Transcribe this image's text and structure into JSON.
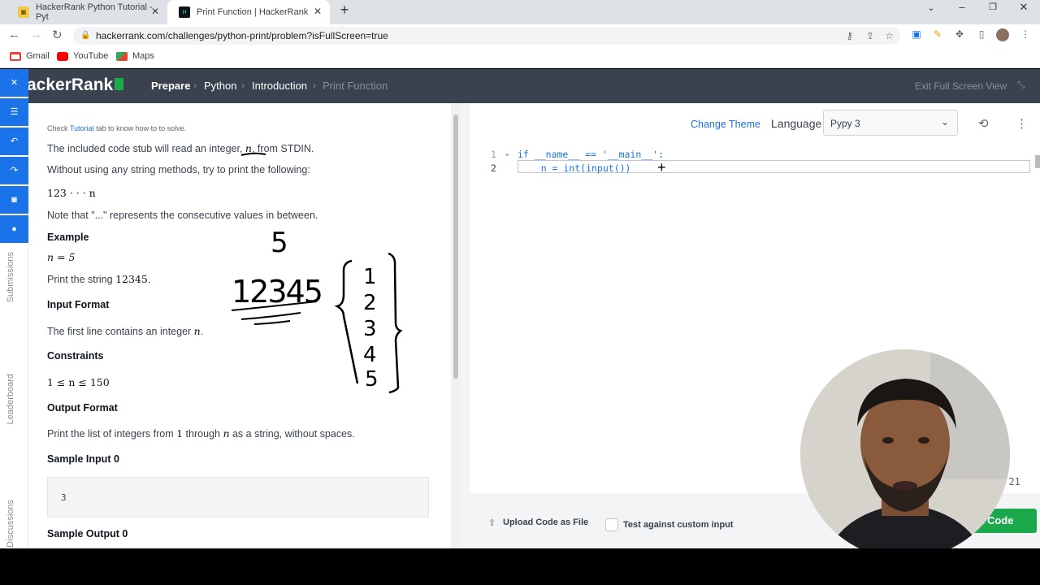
{
  "browser": {
    "tabs": [
      {
        "title": "HackerRank Python Tutorial - Pyt",
        "active": false
      },
      {
        "title": "Print Function | HackerRank",
        "active": true
      }
    ],
    "url": "hackerrank.com/challenges/python-print/problem?isFullScreen=true",
    "bookmarks": [
      "Gmail",
      "YouTube",
      "Maps"
    ]
  },
  "nav": {
    "logo": "ackerRank",
    "breadcrumb": [
      "Prepare",
      "Python",
      "Introduction",
      "Print Function"
    ],
    "exit": "Exit Full Screen View"
  },
  "sidebar": {
    "labels": [
      "Submissions",
      "Leaderboard",
      "Discussions"
    ]
  },
  "problem": {
    "tutorial_pre": "Check",
    "tutorial_link": "Tutorial",
    "tutorial_post": "tab to know how to to solve.",
    "p1_pre": "The included code stub will read an integer,",
    "p1_var": "n",
    "p1_post": ", from STDIN.",
    "p2": "Without using any string methods, try to print the following:",
    "seq": "123 · · · n",
    "p3": "Note that \"...\" represents the consecutive values in between.",
    "example_h": "Example",
    "example_val": "n = 5",
    "print_pre": "Print the string",
    "print_val": "12345",
    "print_post": ".",
    "input_h": "Input Format",
    "input_pre": "The first line contains an integer",
    "input_var": "n",
    "input_post": ".",
    "constraints_h": "Constraints",
    "constraint": "1 ≤ n ≤ 150",
    "output_h": "Output Format",
    "out_pre": "Print the list of integers from",
    "out_1": "1",
    "out_mid": "through",
    "out_n": "n",
    "out_post": "as a string, without spaces.",
    "sample_in_h": "Sample Input 0",
    "sample_in": "3",
    "sample_out_h": "Sample Output 0"
  },
  "annotations": {
    "five": "5",
    "digits": "12345",
    "list": [
      "1",
      "2",
      "3",
      "4",
      "5"
    ]
  },
  "editor": {
    "change_theme": "Change Theme",
    "language_label": "Language",
    "language": "Pypy 3",
    "line1_no": "1",
    "line2_no": "2",
    "line1": "if __name__ == '__main__':",
    "line2": "    n = int(input())",
    "status": ": 21",
    "upload": "Upload Code as File",
    "custom_input": "Test against custom input",
    "submit": "t Code"
  },
  "colors": {
    "nav": "#39424e",
    "green": "#1ba94c",
    "blue": "#1a73e8",
    "keyword": "#1a73e8"
  }
}
